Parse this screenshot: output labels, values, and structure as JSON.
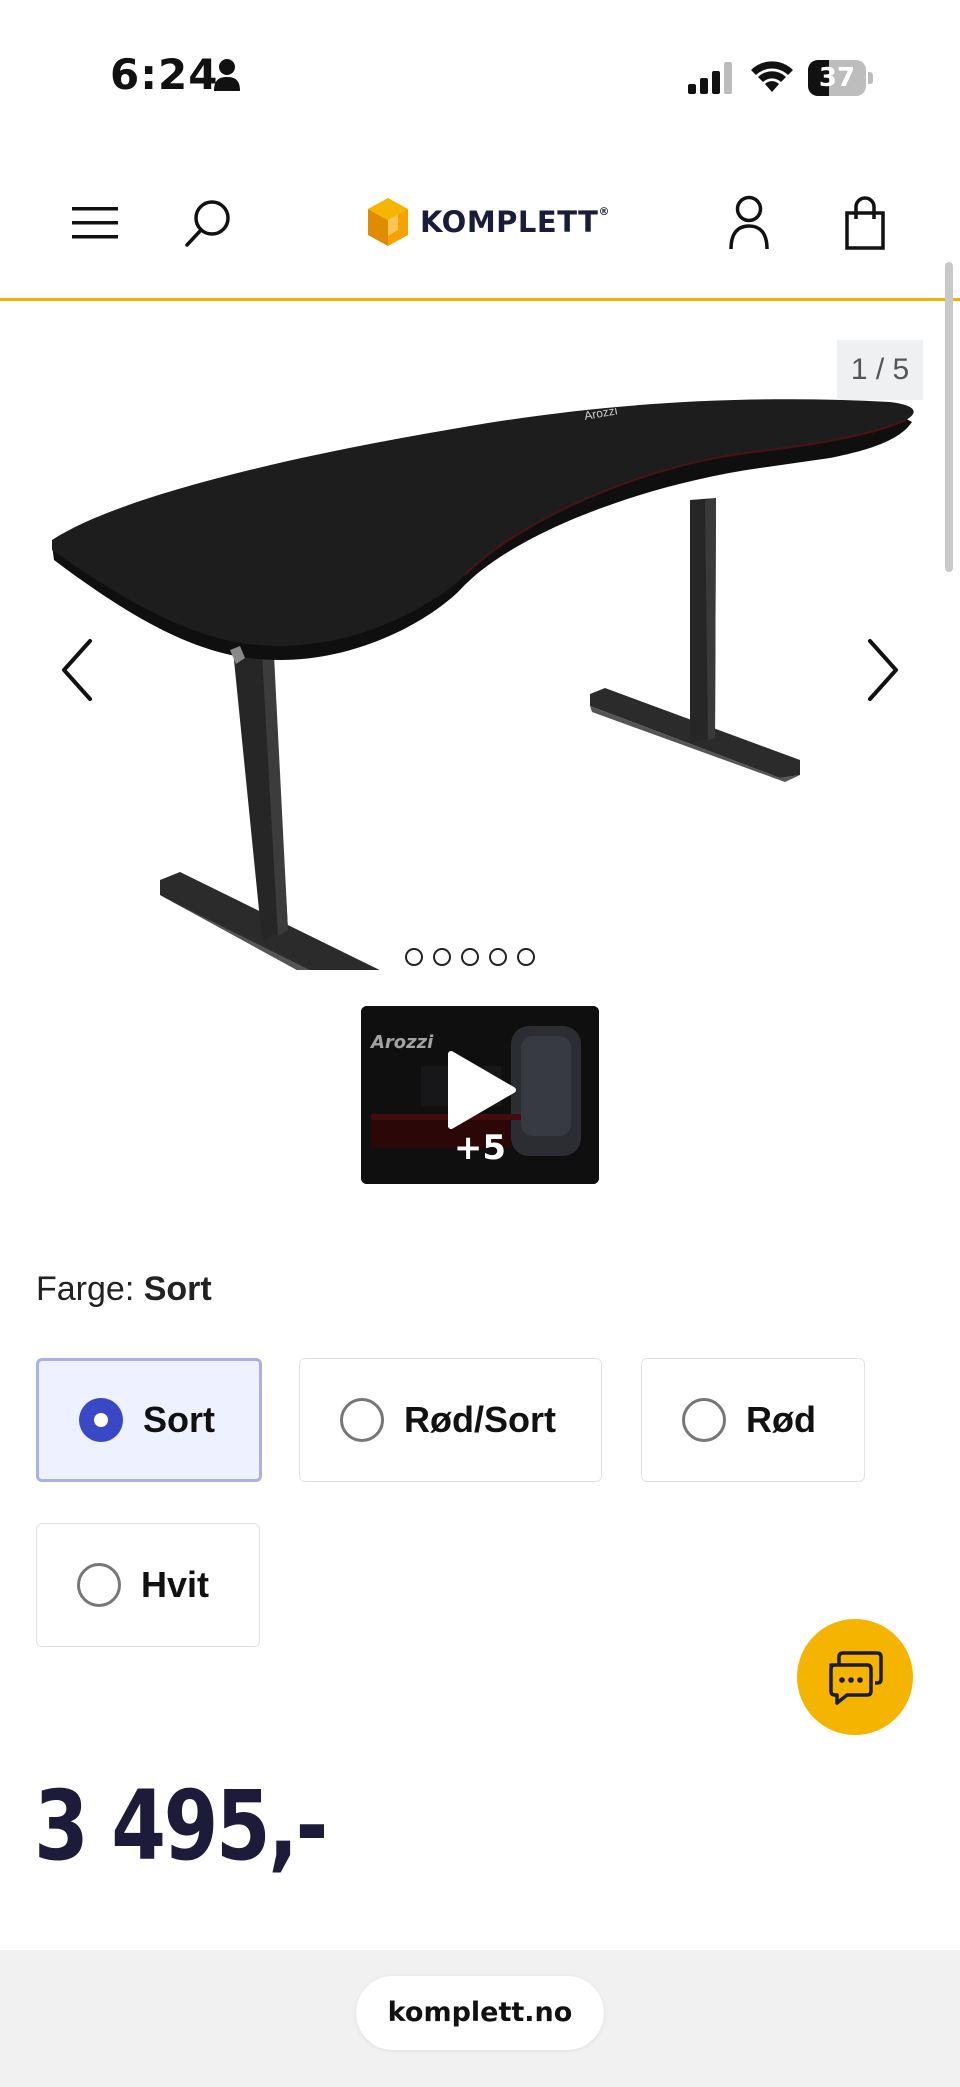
{
  "status_bar": {
    "time": "6:24",
    "battery": "37",
    "battery_fraction": 0.37
  },
  "header": {
    "logo_text": "KOMPLETT",
    "logo_mark": "®",
    "icons": [
      "menu-icon",
      "search-icon",
      "account-icon",
      "cart-icon"
    ]
  },
  "gallery": {
    "counter": "1 / 5",
    "current_image": 1,
    "total_images": 5,
    "video_extra": "+5"
  },
  "product": {
    "color_label": "Farge:",
    "color_selected": "Sort",
    "color_options": [
      "Sort",
      "Rød/Sort",
      "Rød",
      "Hvit"
    ],
    "price": "3 495,-"
  },
  "browser": {
    "url": "komplett.no"
  },
  "colors": {
    "accent_yellow": "#f4b400",
    "radio_selected": "#3a48c6",
    "price_text": "#1c1c3a"
  }
}
